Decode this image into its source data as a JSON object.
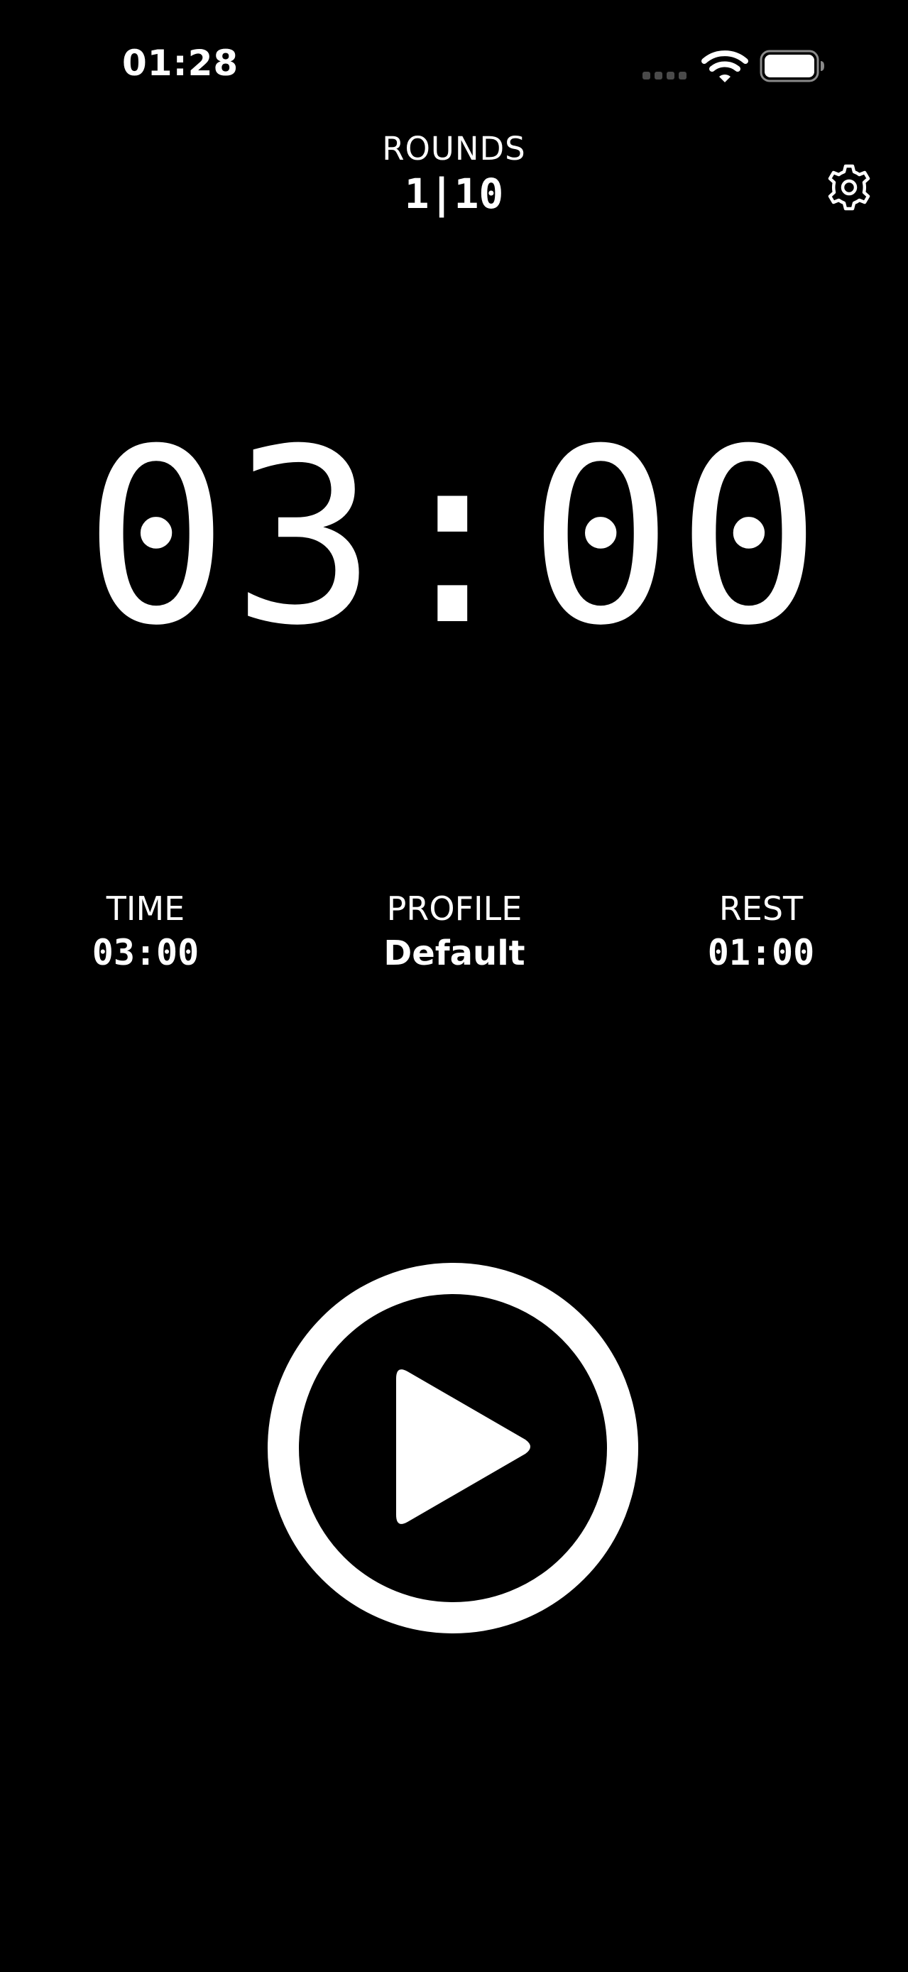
{
  "status_bar": {
    "time": "01:28",
    "icons": [
      "signal-icon",
      "wifi-icon",
      "battery-icon"
    ]
  },
  "header": {
    "rounds_label": "ROUNDS",
    "rounds_value": "1|10",
    "settings_icon": "gear-icon"
  },
  "timer": {
    "display": "03:00"
  },
  "info": {
    "time_label": "TIME",
    "time_value": "03:00",
    "profile_label": "PROFILE",
    "profile_value": "Default",
    "rest_label": "REST",
    "rest_value": "01:00"
  },
  "controls": {
    "play_icon": "play-icon"
  },
  "colors": {
    "background": "#000000",
    "foreground": "#ffffff",
    "inactive_signal": "#4a4a4a"
  }
}
